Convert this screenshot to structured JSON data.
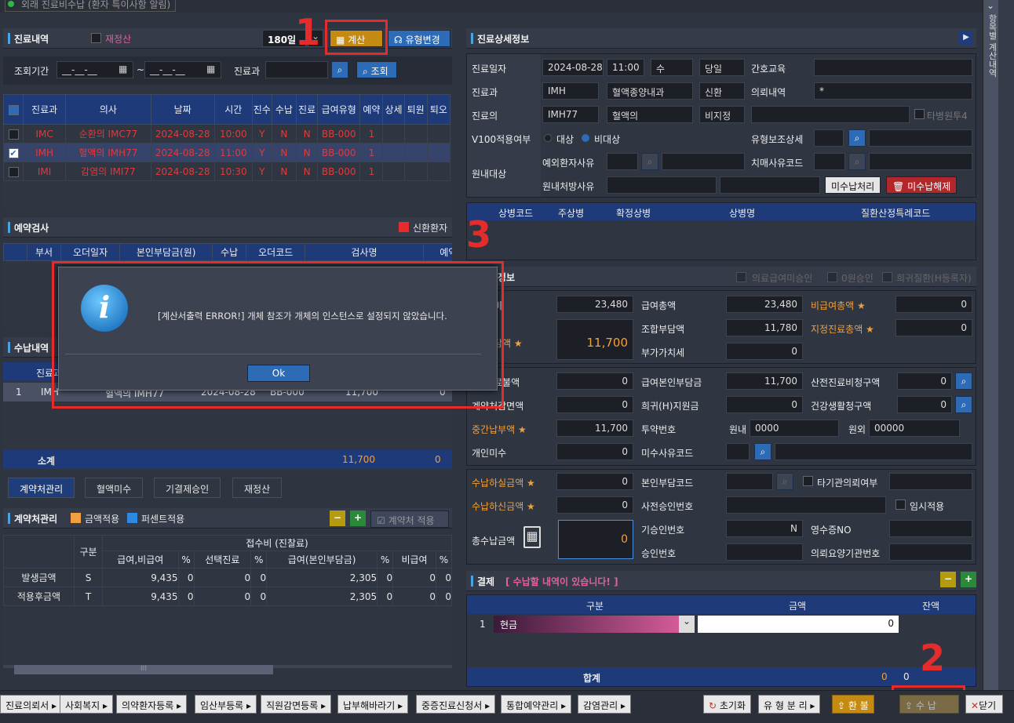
{
  "top": {
    "title": "외래 진료비수납 (환자 특이사항 알림)"
  },
  "side": {
    "label": "항목별 계산내역"
  },
  "hist": {
    "title": "진료내역",
    "recheck": "재정산",
    "days": "180일",
    "calc": "계산",
    "type_change": "유형변경",
    "period_label": "조회기간",
    "date_from": "__-__-__",
    "date_to": "__-__-__",
    "tilde": "~",
    "dept_label": "진료과",
    "search": "조회",
    "cols": [
      "진료과",
      "의사",
      "날짜",
      "시간",
      "진수",
      "수납",
      "진료",
      "급여유형",
      "예약",
      "상세",
      "퇴원",
      "퇴오"
    ],
    "rows": [
      [
        "IMC",
        "순환의 IMC77",
        "2024-08-28",
        "10:00",
        "Y",
        "N",
        "N",
        "BB-000",
        "1"
      ],
      [
        "IMH",
        "혈액의 IMH77",
        "2024-08-28",
        "11:00",
        "Y",
        "N",
        "N",
        "BB-000",
        "1"
      ],
      [
        "IMI",
        "감염의 IMI77",
        "2024-08-28",
        "10:30",
        "Y",
        "N",
        "N",
        "BB-000",
        "1"
      ]
    ]
  },
  "resv": {
    "title": "예약검사",
    "new_patient": "신환환자",
    "cols": [
      "부서",
      "오더일자",
      "본인부담금(원)",
      "수납",
      "오더코드",
      "검사명",
      "예약"
    ]
  },
  "pay_hist": {
    "title": "수납내역",
    "col_dept": "진료과",
    "row": {
      "no": "1",
      "dept": "IMH",
      "doctor": "혈액의 IMH77",
      "date": "2024-08-28",
      "type": "BB-000",
      "amount": "11,700",
      "zero": "0"
    },
    "subtotal": "소계",
    "subtotal_amount": "11,700",
    "subtotal_zero": "0"
  },
  "tabs": [
    "계약처관리",
    "혈액미수",
    "기결제승인",
    "재정산"
  ],
  "contract": {
    "title": "계약처관리",
    "amount": "금액적용",
    "percent": "퍼센트적용",
    "apply": "계약처 적용",
    "col_kind": "구분",
    "col_group": "접수비 (진찰료)",
    "sub": [
      "급여,비급여",
      "%",
      "선택진료",
      "%",
      "급여(본인부담금)",
      "%",
      "비급여",
      "%"
    ],
    "rows": [
      {
        "name": "발생금액",
        "kind": "S",
        "v": [
          "9,435",
          "0",
          "0",
          "0",
          "2,305",
          "0",
          "0",
          "0"
        ]
      },
      {
        "name": "적용후금액",
        "kind": "T",
        "v": [
          "9,435",
          "0",
          "0",
          "0",
          "2,305",
          "0",
          "0",
          "0"
        ]
      }
    ],
    "scroll": "III"
  },
  "detail": {
    "title": "진료상세정보",
    "date_label": "진료일자",
    "date": "2024-08-28",
    "time": "11:00",
    "day": "수",
    "same_day": "당일",
    "edu": "간호교육",
    "dept_label": "진료과",
    "dept": "IMH",
    "dept_name": "혈액종양내과",
    "new_pt": "신환",
    "req_label": "의뢰내역",
    "req": "*",
    "doc_label": "진료의",
    "doc": "IMH77",
    "doc_name": "혈액의",
    "non_design": "비지정",
    "multi": "타병원투4",
    "v100": "V100적용여부",
    "target": "대상",
    "non_target": "비대상",
    "type_assist": "유형보조상세",
    "inhouse": "원내대상",
    "ex_reason": "예외환자사유",
    "dementia": "치매사유코드",
    "rx_reason": "원내처방사유",
    "unpaid": "미수납처리",
    "unpaid_cancel": "미수납해제"
  },
  "dx": {
    "cols": [
      "상병코드",
      "주상병",
      "확정상병",
      "상병명",
      "질환산정특례코드"
    ]
  },
  "amount": {
    "title": "정보",
    "opts": [
      "의료급여미승인",
      "0원승인",
      "희귀질환(H등록자)"
    ],
    "total_label": "비",
    "total": "23,480",
    "pay_total_label": "급여총액",
    "pay_total": "23,480",
    "nonpay_label": "비급여총액 ★",
    "nonpay": "0",
    "self_label": "담액 ★",
    "self": "11,700",
    "union_label": "조합부담액",
    "union": "11,780",
    "designated_label": "지정진료총액 ★",
    "designated": "0",
    "vat_label": "부가가치세",
    "vat": "0",
    "r1l": "료불액",
    "r1": "0",
    "r2l": "급여본인부담금",
    "r2": "11,700",
    "r3l": "산전진료비청구액",
    "r3": "0",
    "r4l": "계약처감면액",
    "r4": "0",
    "r5l": "희귀(H)지원금",
    "r5": "0",
    "r6l": "건강생활청구액",
    "r6": "0",
    "mid_label": "중간납부액 ★",
    "mid": "11,700",
    "dose_label": "투약번호",
    "in_label": "원내",
    "in_no": "0000",
    "out_label": "원외",
    "out_no": "00000",
    "personal_label": "개인미수",
    "personal": "0",
    "unpaid_code": "미수사유코드",
    "bill_label": "수납하실금액 ★",
    "bill": "0",
    "self_code": "본인부담코드",
    "other_req": "타기관의뢰여부",
    "recv_label": "수납하신금액 ★",
    "recv": "0",
    "pre_approval": "사전승인번호",
    "temp": "임시적용",
    "total_pay_label": "총수납금액",
    "total_pay": "0",
    "approval": "기승인번호",
    "approval_val": "N",
    "receipt": "영수증NO",
    "approval2": "승인번호",
    "req_org": "의뢰요양기관번호"
  },
  "settle": {
    "title": "결제",
    "warn": "[ 수납할 내역이 있습니다! ]",
    "col_kind": "구분",
    "col_amt": "금액",
    "col_bal": "잔액",
    "row_no": "1",
    "method": "현금",
    "amt": "0",
    "sum": "합계",
    "sum_amt": "0",
    "sum_bal": "0"
  },
  "dialog": {
    "msg": "[계산서출력 ERROR!]  개체 참조가 개체의 인스턴스로 설정되지 않았습니다.",
    "ok": "Ok"
  },
  "marks": [
    "1",
    "2",
    "3"
  ],
  "bottom": {
    "left": [
      "진료의뢰서",
      "사회복지",
      "의약환자등록",
      "임산부등록",
      "직원감면등록",
      "납부해바라기",
      "중증진료신청서",
      "통합예약관리",
      "감염관리"
    ],
    "reset": "초기화",
    "split": "유 형 분 리",
    "refund": "환 불",
    "pay": "수 납",
    "close": "닫기"
  }
}
